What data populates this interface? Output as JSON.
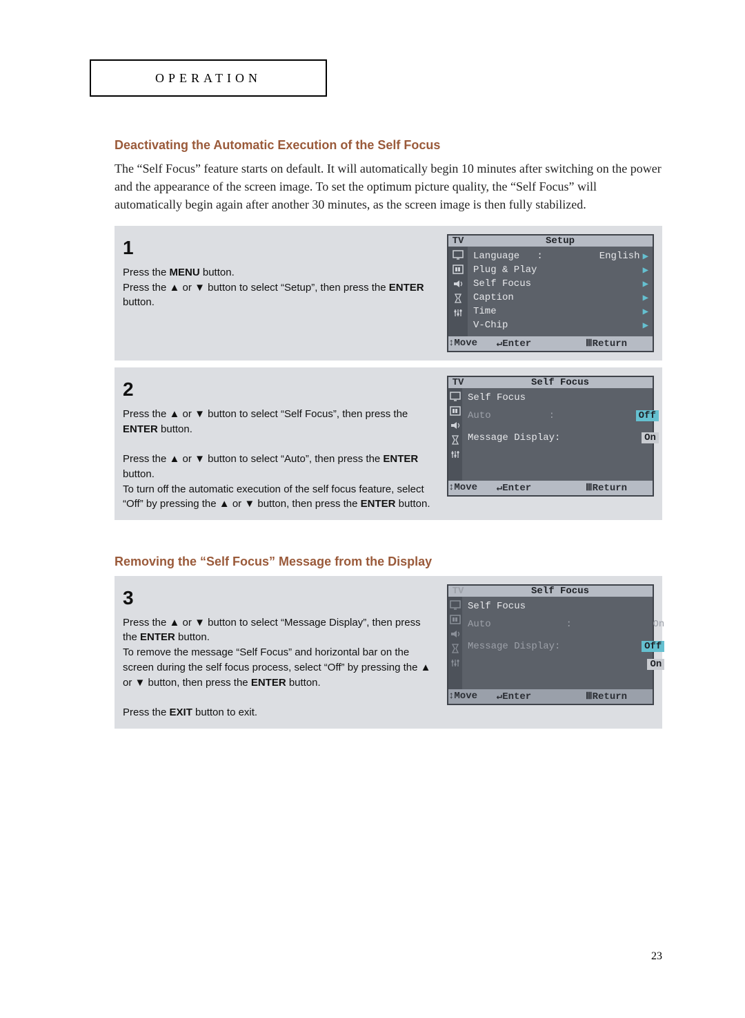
{
  "tab_label": "OPERATION",
  "page_number": "23",
  "section1": {
    "title": "Deactivating the Automatic Execution of the Self Focus",
    "intro": "The “Self Focus” feature starts on default. It will automatically begin 10 minutes after switching on the power and the appearance of the screen image. To set the optimum picture quality, the “Self Focus” will automatically begin again after another 30 minutes, as the screen image is then fully stabilized."
  },
  "step1": {
    "num": "1",
    "line1a": "Press the ",
    "line1b": "MENU",
    "line1c": " button.",
    "line2a": "Press the ",
    "up": "▲",
    "or": " or ",
    "down": "▼",
    "line2b": " button to select “Setup”, then press the ",
    "enter": "ENTER",
    "line2c": " button."
  },
  "osd1": {
    "tv": "TV",
    "title": "Setup",
    "rows": {
      "lang_label": "Language   :",
      "lang_value": "English",
      "plug": "Plug & Play",
      "self": "Self Focus",
      "caption": "Caption",
      "time": "Time",
      "vchip": "V-Chip"
    },
    "footer": {
      "move": "Move",
      "enter": "Enter",
      "return": "Return"
    },
    "glyph": {
      "updown": "↕",
      "enterBtn": "↵",
      "menu": "Ⅲ",
      "tri": "▶"
    }
  },
  "step2": {
    "num": "2",
    "p1a": "Press the ",
    "up": "▲",
    "or": " or ",
    "down": "▼",
    "p1b": " button to select “Self Focus”, then press the ",
    "enter": "ENTER",
    "p1c": " button.",
    "p2a": "Press the ",
    "p2b": " button to select “Auto”, then press the ",
    "p2c": " button.",
    "p3a": "To turn off the automatic execution of the self focus feature, select “Off” by pressing the ",
    "p3b": " button, then press the ",
    "p3c": " button."
  },
  "osd2": {
    "tv": "TV",
    "title": "Self Focus",
    "rows": {
      "self": "Self Focus",
      "auto_label": "Auto",
      "auto_value": "Off",
      "msg_label": "Message Display",
      "msg_value": "On"
    },
    "colon": ":",
    "footer": {
      "move": "Move",
      "enter": "Enter",
      "return": "Return"
    }
  },
  "section2": {
    "title": "Removing the “Self Focus” Message from the Display"
  },
  "step3": {
    "num": "3",
    "p1a": "Press the ",
    "up": "▲",
    "or": " or ",
    "down": "▼",
    "p1b": " button to select “Message Display”, then press the ",
    "enter": "ENTER",
    "p1c": " button.",
    "p2": "To remove the message “Self Focus” and horizontal bar on the screen during the self focus process, select “Off” by pressing the ",
    "p2b": " button, then press the ",
    "p2c": " button.",
    "exit1": "Press the ",
    "exit2": "EXIT",
    "exit3": " button to exit."
  },
  "osd3": {
    "tv": "TV",
    "title": "Self Focus",
    "rows": {
      "self": "Self Focus",
      "auto_label": "Auto",
      "auto_value": "On",
      "msg_label": "Message Display",
      "opt_off": "Off",
      "opt_on": "On"
    },
    "colon": ":",
    "footer": {
      "move": "Move",
      "enter": "Enter",
      "return": "Return"
    }
  },
  "icons": {
    "i1": "tv-icon",
    "i2": "picture-icon",
    "i3": "sound-icon",
    "i4": "timer-icon",
    "i5": "setup-icon"
  }
}
